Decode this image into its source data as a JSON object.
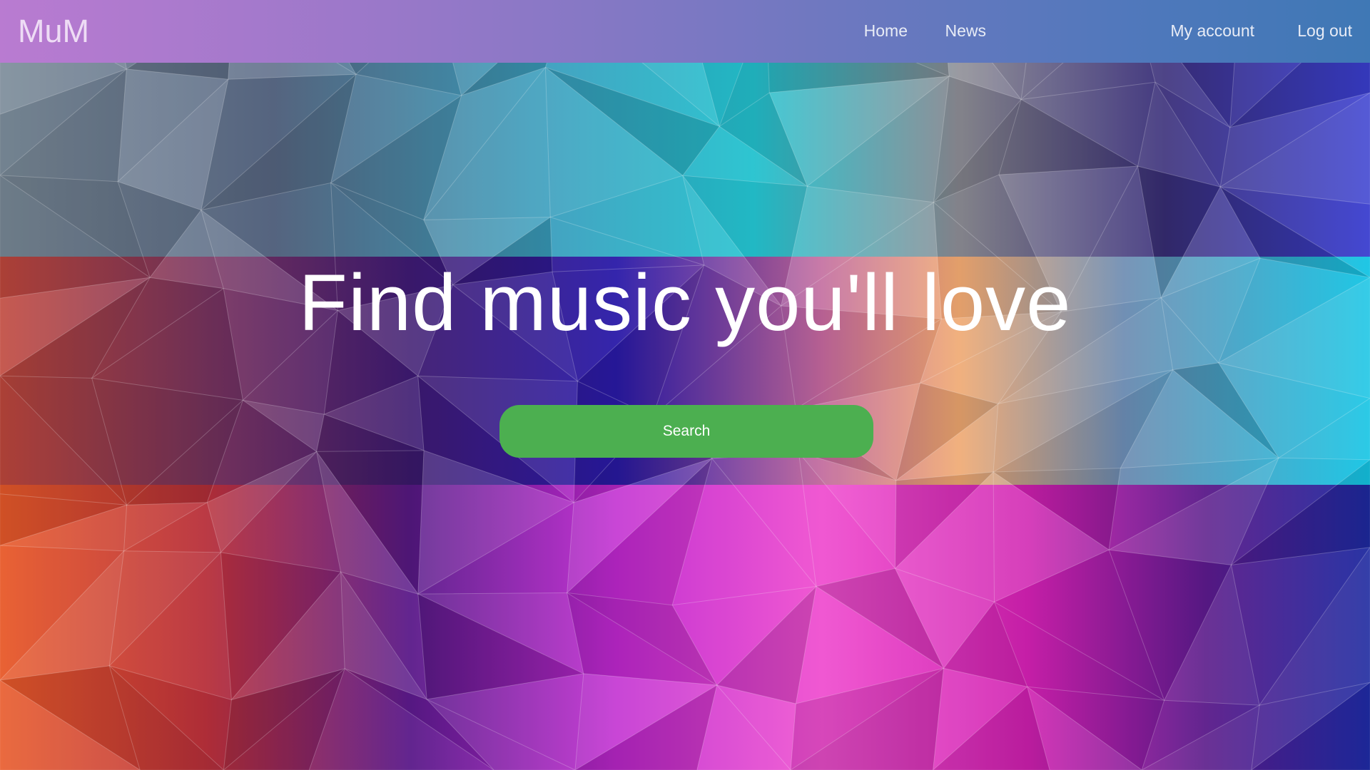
{
  "nav": {
    "logo": "MuM",
    "links": [
      {
        "label": "Home"
      },
      {
        "label": "News"
      },
      {
        "label": "My account"
      },
      {
        "label": "Log out"
      }
    ]
  },
  "hero": {
    "title": "Find music you'll love",
    "search_button_label": "Search"
  },
  "colors": {
    "nav_gradient_start": "#b97bd1",
    "nav_gradient_end": "#3f78b5",
    "button_green": "#4caf50",
    "text": "#ffffff"
  }
}
